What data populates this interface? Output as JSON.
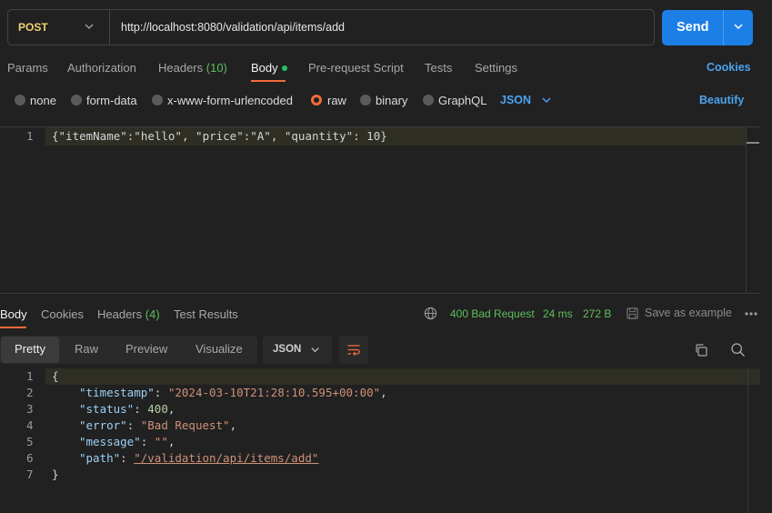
{
  "request": {
    "method": "POST",
    "url": "http://localhost:8080/validation/api/items/add",
    "send_label": "Send"
  },
  "request_tabs": [
    {
      "label": "Params"
    },
    {
      "label": "Authorization"
    },
    {
      "label": "Headers",
      "count": "(10)"
    },
    {
      "label": "Body",
      "active": true
    },
    {
      "label": "Pre-request Script"
    },
    {
      "label": "Tests"
    },
    {
      "label": "Settings"
    }
  ],
  "cookies_label": "Cookies",
  "body_types": [
    {
      "label": "none"
    },
    {
      "label": "form-data"
    },
    {
      "label": "x-www-form-urlencoded"
    },
    {
      "label": "raw",
      "selected": true
    },
    {
      "label": "binary"
    },
    {
      "label": "GraphQL"
    }
  ],
  "body_language": "JSON",
  "beautify_label": "Beautify",
  "request_body": {
    "line_number": "1",
    "text": "{\"itemName\":\"hello\", \"price\":\"A\", \"quantity\": 10}"
  },
  "response_tabs": [
    {
      "label": "Body",
      "active": true
    },
    {
      "label": "Cookies"
    },
    {
      "label": "Headers",
      "count": "(4)"
    },
    {
      "label": "Test Results"
    }
  ],
  "response_status": {
    "status": "400 Bad Request",
    "time": "24 ms",
    "size": "272 B"
  },
  "save_example_label": "Save as example",
  "view_modes": [
    "Pretty",
    "Raw",
    "Preview",
    "Visualize"
  ],
  "active_view": "Pretty",
  "response_format": "JSON",
  "response_lines": [
    {
      "n": "1",
      "text": "{"
    },
    {
      "n": "2",
      "key": "\"timestamp\"",
      "value": "\"2024-03-10T21:28:10.595+00:00\"",
      "trail": ","
    },
    {
      "n": "3",
      "key": "\"status\"",
      "value": "400",
      "trail": ","
    },
    {
      "n": "4",
      "key": "\"error\"",
      "value": "\"Bad Request\"",
      "trail": ","
    },
    {
      "n": "5",
      "key": "\"message\"",
      "value": "\"\"",
      "trail": ","
    },
    {
      "n": "6",
      "key": "\"path\"",
      "value": "\"/validation/api/items/add\"",
      "trail": ""
    },
    {
      "n": "7",
      "text": "}"
    }
  ],
  "colors": {
    "accent": "#f26b3a",
    "send": "#1c7fe6",
    "link": "#4aa3ef",
    "status_ok": "#5bbf5b",
    "method": "#f0d070"
  },
  "icons": [
    "chevron-down-icon",
    "globe-icon",
    "save-icon",
    "more-icon",
    "wrap-icon",
    "copy-icon",
    "search-icon"
  ]
}
